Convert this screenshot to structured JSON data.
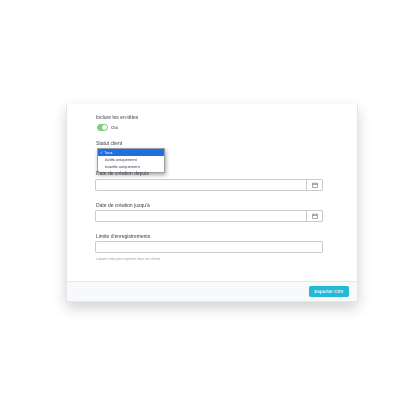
{
  "form": {
    "include_headers": {
      "label": "Inclure les en-têtes",
      "toggle_text": "Oui",
      "on": true
    },
    "status": {
      "label": "Statut client",
      "options": [
        {
          "check": "✓",
          "label": "Tous",
          "selected": true
        },
        {
          "check": "",
          "label": "Actifs uniquement",
          "selected": false
        },
        {
          "check": "",
          "label": "Inactifs uniquement",
          "selected": false
        }
      ]
    },
    "date_from": {
      "label": "Date de création depuis",
      "value": ""
    },
    "date_to": {
      "label": "Date de création jusqu'à",
      "value": ""
    },
    "limit": {
      "label": "Limite d'enregistrements",
      "value": "",
      "help": "Laisser vide pour exporter tous les clients"
    }
  },
  "footer": {
    "export_label": "Exporter CSV"
  },
  "colors": {
    "toggle_on": "#78d07d",
    "primary_button": "#25b9d7",
    "selected_option": "#1e6fe0"
  },
  "icons": {
    "date_picker": "calendar-icon"
  }
}
